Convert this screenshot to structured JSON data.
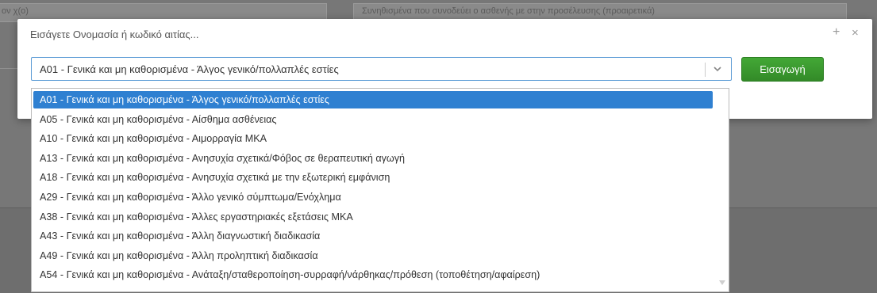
{
  "background": {
    "left_field_text": "ον χ(ο)",
    "right_field_text": "Συνηθισμένα που συνοδεύει ο ασθενής με στην προσέλευσης (προαιρετικά)"
  },
  "modal": {
    "title": "Εισάγετε Ονομασία ή κωδικό αιτίας...",
    "expand_symbol": "+",
    "close_symbol": "×",
    "select_value": "A01 - Γενικά και μη καθορισμένα - Άλγος γενικό/πολλαπλές εστίες",
    "insert_button": "Εισαγωγή"
  },
  "dropdown": {
    "options": [
      "A01 - Γενικά και μη καθορισμένα - Άλγος γενικό/πολλαπλές εστίες",
      "A05 - Γενικά και μη καθορισμένα - Αίσθημα ασθένειας",
      "A10 - Γενικά και μη καθορισμένα - Αιμορραγία ΜΚΑ",
      "A13 - Γενικά και μη καθορισμένα - Ανησυχία σχετικά/Φόβος σε θεραπευτική αγωγή",
      "A18 - Γενικά και μη καθορισμένα - Ανησυχία σχετικά με την εξωτερική εμφάνιση",
      "A29 - Γενικά και μη καθορισμένα - Άλλο γενικό σύμπτωμα/Ενόχλημα",
      "A38 - Γενικά και μη καθορισμένα - Άλλες εργαστηριακές εξετάσεις ΜΚΑ",
      "A43 - Γενικά και μη καθορισμένα - Άλλη διαγνωστική διαδικασία",
      "A49 - Γενικά και μη καθορισμένα - Άλλη προληπτική διαδικασία",
      "A54 - Γενικά και μη καθορισμένα - Ανάταξη/σταθεροποίηση-συρραφή/νάρθηκας/πρόθεση (τοποθέτηση/αφαίρεση)"
    ]
  },
  "colors": {
    "accent": "#2f80d1",
    "button": "#3a9a2e"
  },
  "icons": {
    "select_caret": "chevron-down-icon",
    "scroll_caret": "caret-down-icon"
  }
}
